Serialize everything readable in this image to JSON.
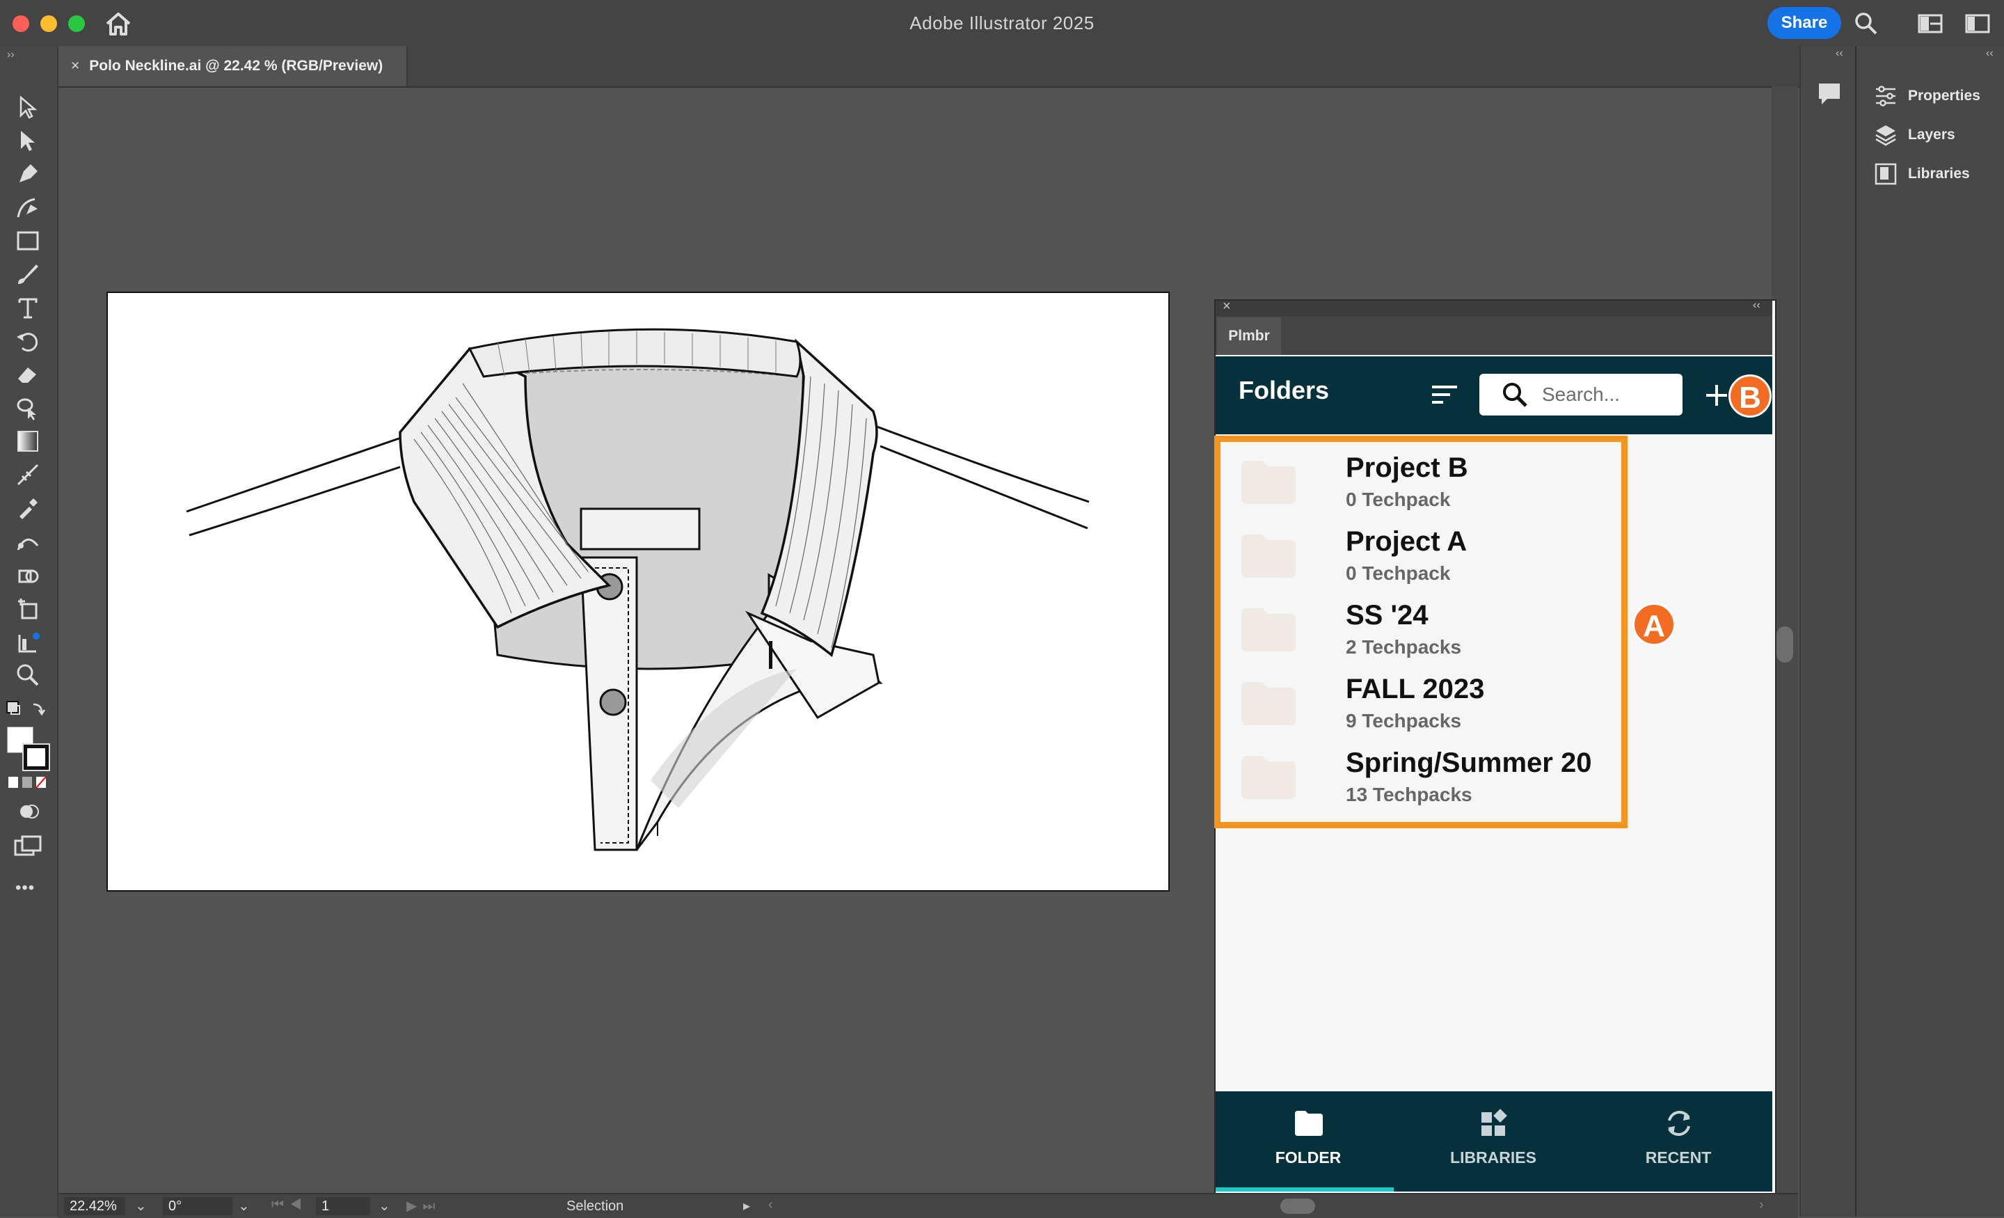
{
  "app": {
    "title": "Adobe Illustrator 2025",
    "share_label": "Share"
  },
  "document": {
    "tab_title": "Polo Neckline.ai @ 22.42 % (RGB/Preview)",
    "close_glyph": "×"
  },
  "toolbar": {
    "tools": [
      "selection-tool",
      "direct-selection-tool",
      "pen-tool",
      "curvature-tool",
      "rectangle-tool",
      "paintbrush-tool",
      "type-tool",
      "rotate-tool",
      "eraser-tool",
      "shape-builder-tool",
      "gradient-tool",
      "mesh-tool",
      "eyedropper-tool",
      "blend-tool",
      "free-transform-tool",
      "puppet-warp-tool",
      "zoom-tool"
    ],
    "more_label": "•••"
  },
  "right_dock": {
    "items": [
      {
        "label": "Properties",
        "icon": "properties-icon"
      },
      {
        "label": "Layers",
        "icon": "layers-icon"
      },
      {
        "label": "Libraries",
        "icon": "libraries-icon"
      }
    ]
  },
  "status_bar": {
    "zoom": "22.42%",
    "rotation": "0°",
    "artboard": "1",
    "mode": "Selection"
  },
  "plmbr": {
    "tab_label": "Plmbr",
    "header_title": "Folders",
    "search_placeholder": "Search...",
    "folders": [
      {
        "name": "Project B",
        "count": "0 Techpack"
      },
      {
        "name": "Project A",
        "count": "0 Techpack"
      },
      {
        "name": "SS '24",
        "count": "2 Techpacks"
      },
      {
        "name": "FALL 2023",
        "count": "9 Techpacks"
      },
      {
        "name": "Spring/Summer 20",
        "count": "13 Techpacks"
      }
    ],
    "annotations": {
      "a": "A",
      "b": "B"
    },
    "nav": [
      {
        "label": "FOLDER",
        "icon": "folder-icon",
        "active": true
      },
      {
        "label": "LIBRARIES",
        "icon": "libraries-icon",
        "active": false
      },
      {
        "label": "RECENT",
        "icon": "recent-icon",
        "active": false
      }
    ]
  },
  "colors": {
    "accent": "#f7941d",
    "panel_dark": "#04313b",
    "share": "#1473e6",
    "nav_active": "#1ec8c8"
  }
}
